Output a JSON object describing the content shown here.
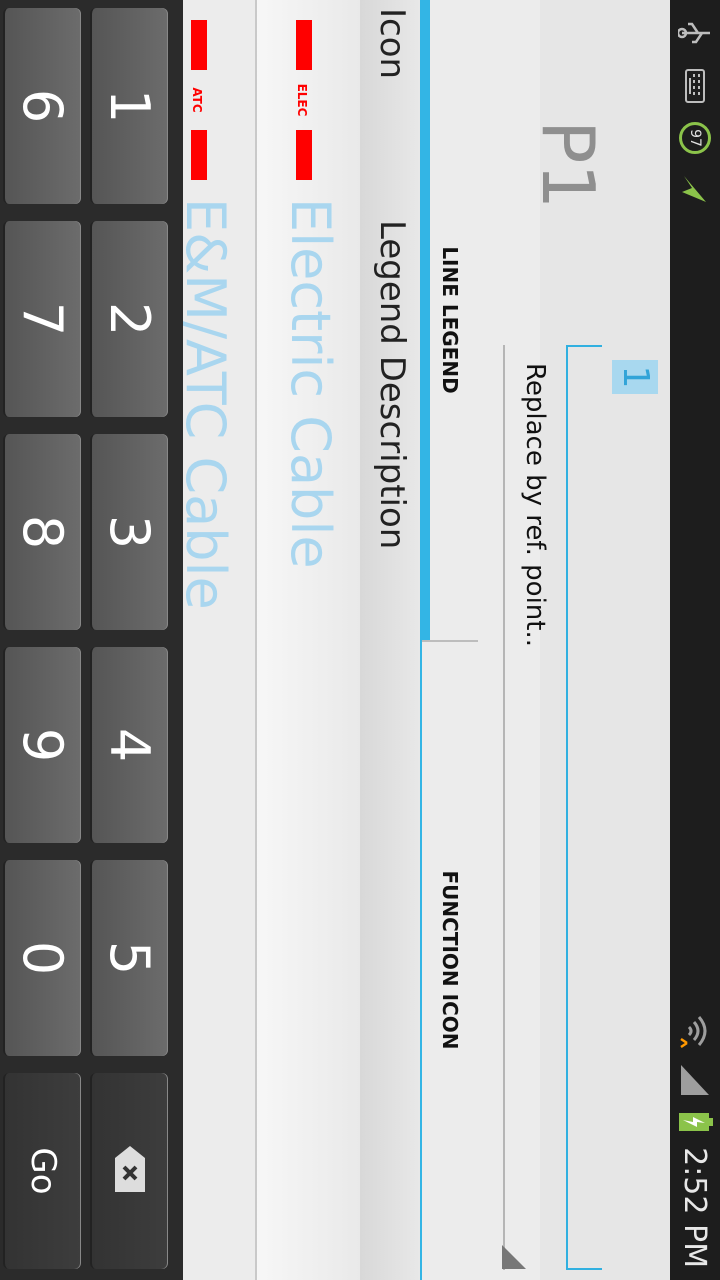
{
  "status_bar": {
    "time": "2:52 PM",
    "battery_badge": "97",
    "icons": [
      "usb-icon",
      "keyboard-icon",
      "battery-level-badge",
      "send-icon",
      "wifi-icon",
      "signal-icon",
      "battery-charging-icon"
    ]
  },
  "header": {
    "title": "P1",
    "edit_value": "1",
    "spinner_label": "Replace by ref. point.."
  },
  "tabs": [
    {
      "label": "LINE LEGEND",
      "selected": true
    },
    {
      "label": "FUNCTION ICON",
      "selected": false
    }
  ],
  "table": {
    "col_icon": "Icon",
    "col_desc": "Legend Description",
    "rows": [
      {
        "icon_text": "ELEC",
        "description": "Electric Cable",
        "color": "#ff0000"
      },
      {
        "icon_text": "ATC",
        "description": "E&M/ATC Cable",
        "color": "#ff0000"
      }
    ]
  },
  "keyboard": {
    "row1": [
      "1",
      "2",
      "3",
      "4",
      "5"
    ],
    "row2": [
      "6",
      "7",
      "8",
      "9",
      "0"
    ],
    "delete_label": "",
    "go_label": "Go"
  }
}
